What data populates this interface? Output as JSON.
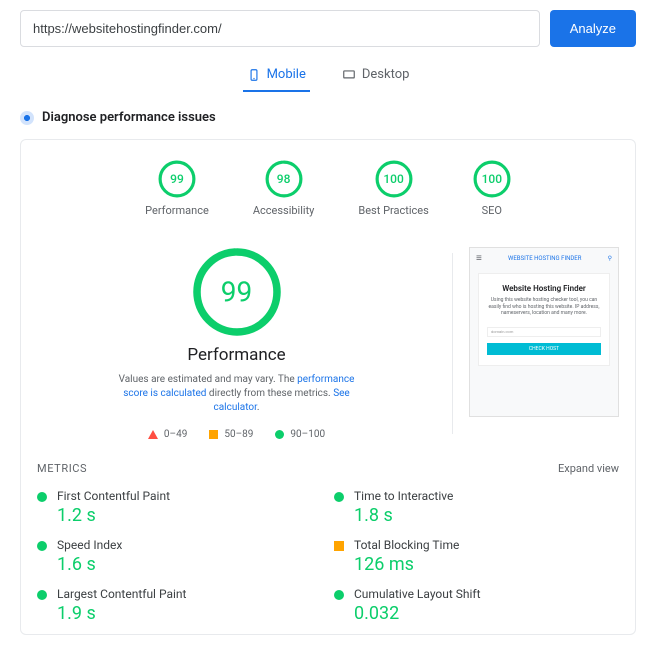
{
  "input": {
    "url": "https://websitehostingfinder.com/"
  },
  "buttons": {
    "analyze": "Analyze"
  },
  "tabs": {
    "mobile": "Mobile",
    "desktop": "Desktop"
  },
  "section": {
    "title": "Diagnose performance issues"
  },
  "scores": [
    {
      "value": "99",
      "pct": 99,
      "label": "Performance"
    },
    {
      "value": "98",
      "pct": 98,
      "label": "Accessibility"
    },
    {
      "value": "100",
      "pct": 100,
      "label": "Best Practices"
    },
    {
      "value": "100",
      "pct": 100,
      "label": "SEO"
    }
  ],
  "big": {
    "value": "99",
    "pct": 99,
    "title": "Performance"
  },
  "desc": {
    "prefix": "Values are estimated and may vary. The ",
    "link1": "performance score is calculated",
    "mid": " directly from these metrics. ",
    "link2": "See calculator"
  },
  "legend": {
    "r1": "0–49",
    "r2": "50–89",
    "r3": "90–100"
  },
  "preview": {
    "brand": "WEBSITE HOSTING FINDER",
    "headline": "Website Hosting Finder",
    "body": "Using this website hosting checker tool, you can easily find who is hosting this website. IP address, nameservers, location and many more.",
    "placeholder": "domain.com",
    "cta": "CHECK HOST"
  },
  "metricsHeader": {
    "title": "METRICS",
    "expand": "Expand view"
  },
  "metrics": [
    {
      "name": "First Contentful Paint",
      "value": "1.2 s",
      "shape": "cir"
    },
    {
      "name": "Time to Interactive",
      "value": "1.8 s",
      "shape": "cir"
    },
    {
      "name": "Speed Index",
      "value": "1.6 s",
      "shape": "cir"
    },
    {
      "name": "Total Blocking Time",
      "value": "126 ms",
      "shape": "sq"
    },
    {
      "name": "Largest Contentful Paint",
      "value": "1.9 s",
      "shape": "cir"
    },
    {
      "name": "Cumulative Layout Shift",
      "value": "0.032",
      "shape": "cir"
    }
  ],
  "colors": {
    "green": "#0cce6b",
    "orange": "#ffa400",
    "red": "#ff4e42",
    "blue": "#1a73e8"
  }
}
